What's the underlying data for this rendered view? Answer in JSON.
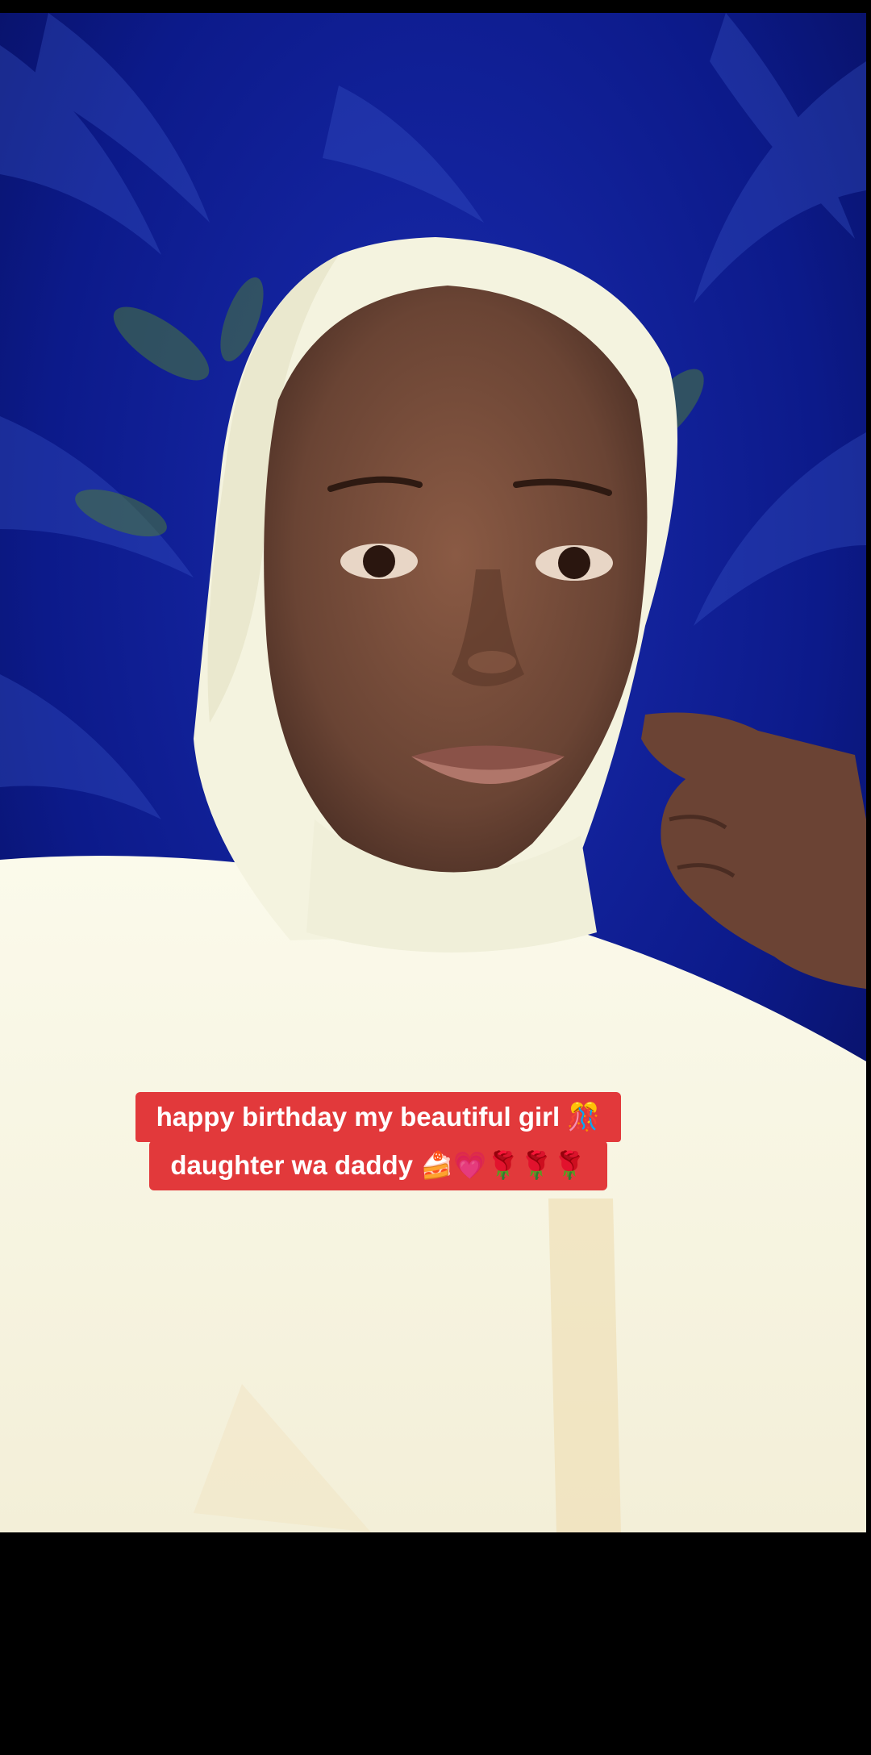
{
  "caption": {
    "line1": "happy birthday my beautiful girl 🎊",
    "line2": "daughter wa daddy 🍰💗🌹🌹🌹"
  },
  "colors": {
    "caption_bg": "#e2393b",
    "caption_text": "#ffffff",
    "backdrop": "#0b1a8c",
    "hijab": "#f4f3df",
    "skin": "#6a4634",
    "letterbox": "#000000"
  }
}
